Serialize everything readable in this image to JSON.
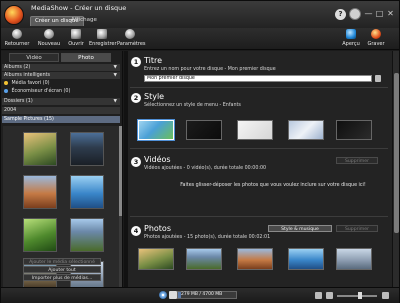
{
  "window": {
    "title": "MediaShow - Créer un disque",
    "tabs": [
      "Créer un disque",
      "Affichage"
    ],
    "controls": [
      "?",
      "—",
      "□",
      "✕"
    ]
  },
  "toolbar": {
    "left": [
      "Retourner",
      "Nouveau",
      "Ouvrir",
      "Enregistrer",
      "Paramètres"
    ],
    "right": [
      "Aperçu",
      "Graver"
    ]
  },
  "left_panel": {
    "tabs": [
      "Vidéo",
      "Photo"
    ],
    "tree": [
      {
        "label": "Albums (2)",
        "kind": "header"
      },
      {
        "label": "Albums intelligents",
        "kind": "header"
      },
      {
        "label": "Média favori (0)",
        "kind": "item"
      },
      {
        "label": "Économiseur d'écran (0)",
        "kind": "item"
      },
      {
        "label": "Dossiers (1)",
        "kind": "header"
      },
      {
        "label": "2004",
        "kind": "header"
      },
      {
        "label": "Sample Pictures (15)",
        "kind": "selected"
      }
    ],
    "buttons": [
      "Ajouter le média sélectionné",
      "Ajouter tout",
      "Importer plus de médias..."
    ]
  },
  "sections": {
    "titre": {
      "num": "1",
      "title": "Titre",
      "subtitle": "Entrez un nom pour votre disque - Mon premier disque",
      "input_value": "Mon premier disque"
    },
    "style": {
      "num": "2",
      "title": "Style",
      "subtitle": "Sélectionnez un style de menu - Enfants"
    },
    "videos": {
      "num": "3",
      "title": "Vidéos",
      "subtitle": "Vidéos ajoutées - 0 vidéo(s), durée totale 00:00:00",
      "delete_label": "Supprimer",
      "hint": "Faites glisser-déposer les photos que vous voulez inclure sur votre disque ici!"
    },
    "photos": {
      "num": "4",
      "title": "Photos",
      "subtitle": "Photos ajoutées - 15 photo(s), durée totale 00:02:01",
      "style_music_label": "Style & musique",
      "delete_label": "Supprimer"
    }
  },
  "status": {
    "capacity_text": "279 MB / 4700 MB",
    "capacity_fraction": 0.06
  },
  "colors": {
    "window_bg": "#1b1b1b",
    "panel_bg": "#232323",
    "selection": "#5d6b82",
    "accent": "#4f8fd6"
  }
}
